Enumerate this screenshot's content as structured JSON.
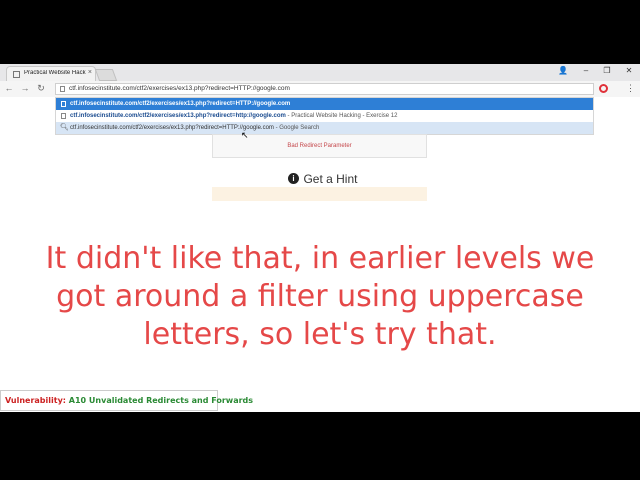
{
  "browser": {
    "tab_title": "Practical Website Hacking",
    "tab_close": "×",
    "window_controls": {
      "user": "👤",
      "minimize": "–",
      "restore": "❐",
      "close": "✕"
    },
    "nav": {
      "back": "←",
      "forward": "→",
      "reload": "↻"
    },
    "address_value": "ctf.infosecinstitute.com/ctf2/exercises/ex13.php?redirect=HTTP://google.com",
    "menu": "⋮",
    "suggestions": [
      {
        "url": "ctf.infosecinstitute.com/ctf2/exercises/ex13.php?redirect=HTTP://google.com",
        "suffix": "",
        "selected": true
      },
      {
        "url": "ctf.infosecinstitute.com/ctf2/exercises/ex13.php?redirect=http://google.com",
        "suffix": " - Practical Website Hacking - Exercise 12",
        "selected": false
      },
      {
        "url": "ctf.infosecinstitute.com/ctf2/exercises/ex13.php?redirect=HTTP://google.com",
        "suffix": " - Google Search",
        "selected": false
      }
    ]
  },
  "page": {
    "error_message": "Bad Redirect Parameter",
    "hint_icon": "i",
    "hint_label": "Get a Hint"
  },
  "caption": {
    "line1": "It didn't like that, in earlier levels we",
    "line2": "got around a filter using uppercase",
    "line3": "letters, so let's try that."
  },
  "banner": {
    "key": "Vulnerability:",
    "value": "A10 Unvalidated Redirects and Forwards"
  },
  "colors": {
    "caption": "#e54848",
    "selected_suggestion": "#2e7fd6",
    "error_text": "#c5474b"
  }
}
